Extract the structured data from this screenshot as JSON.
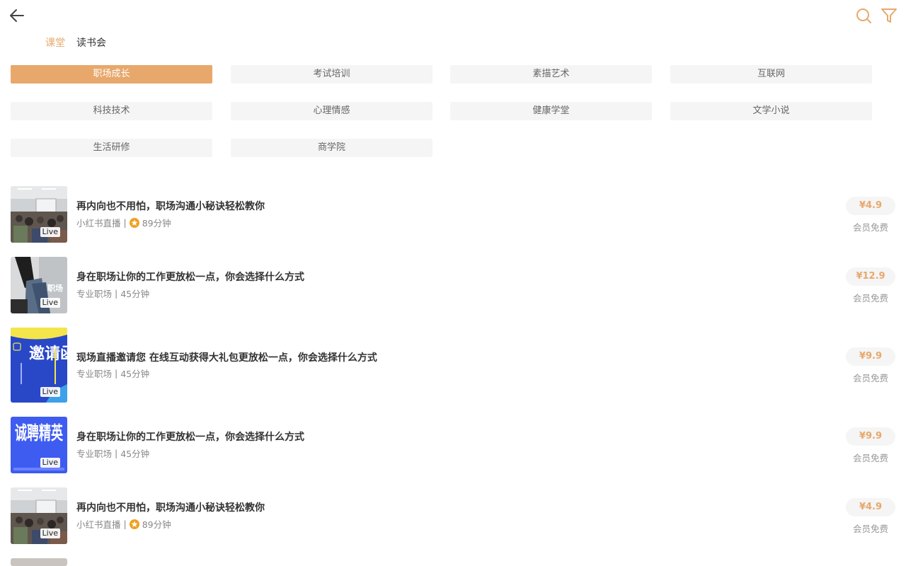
{
  "header": {
    "back_icon": "arrow-left-icon",
    "search_icon": "search-icon",
    "filter_icon": "filter-icon",
    "accent_color": "#e8a86c"
  },
  "tabs": [
    {
      "label": "课堂",
      "active": true
    },
    {
      "label": "读书会",
      "active": false
    }
  ],
  "categories": [
    {
      "label": "职场成长",
      "active": true
    },
    {
      "label": "考试培训",
      "active": false
    },
    {
      "label": "素描艺术",
      "active": false
    },
    {
      "label": "互联网",
      "active": false
    },
    {
      "label": "科技技术",
      "active": false
    },
    {
      "label": "心理情感",
      "active": false
    },
    {
      "label": "健康学堂",
      "active": false
    },
    {
      "label": "文学小说",
      "active": false
    },
    {
      "label": "生活研修",
      "active": false
    },
    {
      "label": "商学院",
      "active": false
    }
  ],
  "courses": [
    {
      "title": "再内向也不用怕，职场沟通小秘诀轻松教你",
      "source": "小红书直播",
      "separator": "|",
      "duration": "89分钟",
      "has_medal": true,
      "live_label": "Live",
      "price": "¥4.9",
      "member_label": "会员免费",
      "thumb": "classroom"
    },
    {
      "title": "身在职场让你的工作更放松一点，你会选择什么方式",
      "source": "专业职场",
      "separator": "|",
      "duration": "45分钟",
      "has_medal": false,
      "live_label": "Live",
      "price": "¥12.9",
      "member_label": "会员免费",
      "thumb": "person"
    },
    {
      "title": "现场直播邀请您 在线互动获得大礼包更放松一点，你会选择什么方式",
      "source": "专业职场",
      "separator": "|",
      "duration": "45分钟",
      "has_medal": false,
      "live_label": "Live",
      "price": "¥9.9",
      "member_label": "会员免费",
      "thumb": "invite",
      "thumb_text": "邀请函"
    },
    {
      "title": "身在职场让你的工作更放松一点，你会选择什么方式",
      "source": "专业职场",
      "separator": "|",
      "duration": "45分钟",
      "has_medal": false,
      "live_label": "Live",
      "price": "¥9.9",
      "member_label": "会员免费",
      "thumb": "recruit",
      "thumb_text": "诚聘精英"
    },
    {
      "title": "再内向也不用怕，职场沟通小秘诀轻松教你",
      "source": "小红书直播",
      "separator": "|",
      "duration": "89分钟",
      "has_medal": true,
      "live_label": "Live",
      "price": "¥4.9",
      "member_label": "会员免费",
      "thumb": "classroom"
    }
  ]
}
